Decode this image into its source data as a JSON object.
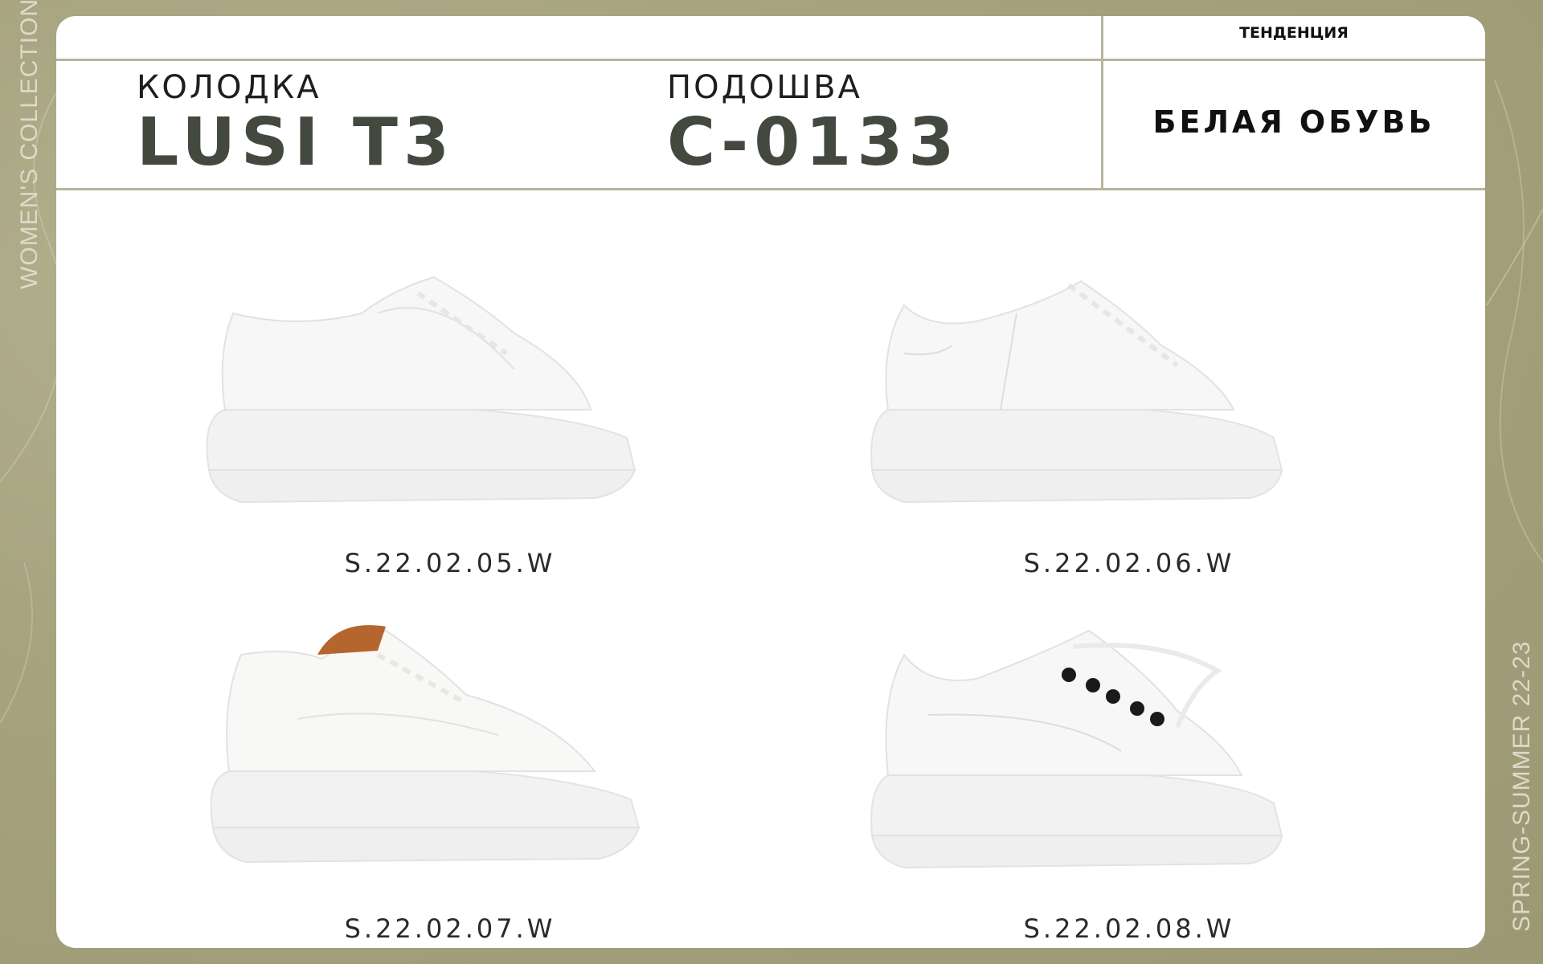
{
  "side": {
    "left": "WOMEN'S COLLECTION",
    "right": "SPRING-SUMMER 22-23"
  },
  "header": {
    "last_label": "КОЛОДКА",
    "last_value": "LUSI T3",
    "sole_label": "ПОДОШВА",
    "sole_value": "С-0133",
    "trend_label": "ТЕНДЕНЦИЯ",
    "trend_value": "БЕЛАЯ ОБУВЬ"
  },
  "products": [
    {
      "code": "S.22.02.05.W",
      "accent": "#ffffff"
    },
    {
      "code": "S.22.02.06.W",
      "accent": "#ffffff"
    },
    {
      "code": "S.22.02.07.W",
      "accent": "#b5652e"
    },
    {
      "code": "S.22.02.08.W",
      "accent": "#1a1a1a"
    }
  ],
  "colors": {
    "background": "#a7a37f",
    "card": "#ffffff",
    "divider": "#b7b49a",
    "title": "#444940"
  }
}
